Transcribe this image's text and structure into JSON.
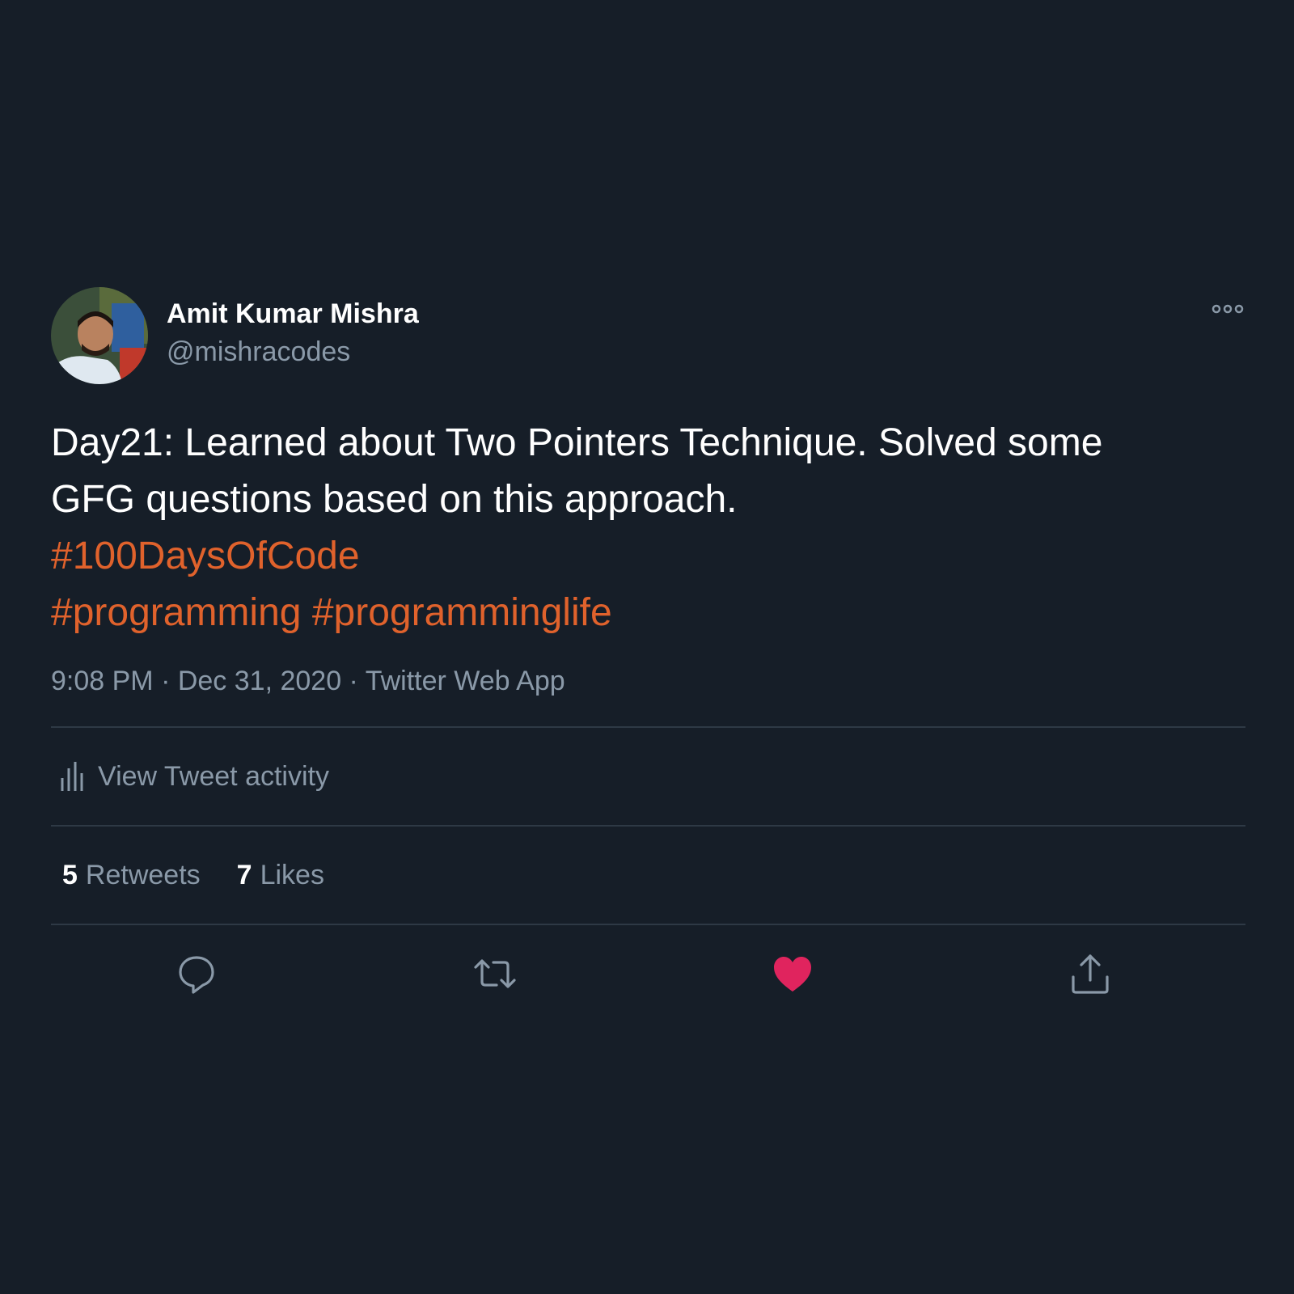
{
  "user": {
    "name": "Amit Kumar Mishra",
    "handle": "@mishracodes"
  },
  "tweet": {
    "lines": [
      [
        {
          "text": "Day21: Learned about Two Pointers Technique. Solved some",
          "type": "text"
        }
      ],
      [
        {
          "text": "GFG questions based on this approach.",
          "type": "text"
        }
      ],
      [
        {
          "text": "#100DaysOfCode",
          "type": "hashtag"
        }
      ],
      [
        {
          "text": "#programming",
          "type": "hashtag"
        },
        {
          "text": " ",
          "type": "text"
        },
        {
          "text": "#programminglife",
          "type": "hashtag"
        }
      ]
    ]
  },
  "meta": {
    "time": "9:08 PM",
    "separator": " · ",
    "date": "Dec 31, 2020",
    "source": "Twitter Web App"
  },
  "activity": {
    "label": "View Tweet activity"
  },
  "stats": {
    "retweets_count": "5",
    "retweets_label": "Retweets",
    "likes_count": "7",
    "likes_label": "Likes"
  },
  "actions": {
    "icons": [
      "reply-icon",
      "retweet-icon",
      "like-icon",
      "share-icon"
    ],
    "liked": true
  },
  "colors": {
    "background": "#161e28",
    "primary_text": "#ffffff",
    "secondary_text": "#8a99a8",
    "hashtag": "#e0622c",
    "like": "#e0245e",
    "divider": "#2e3945"
  }
}
